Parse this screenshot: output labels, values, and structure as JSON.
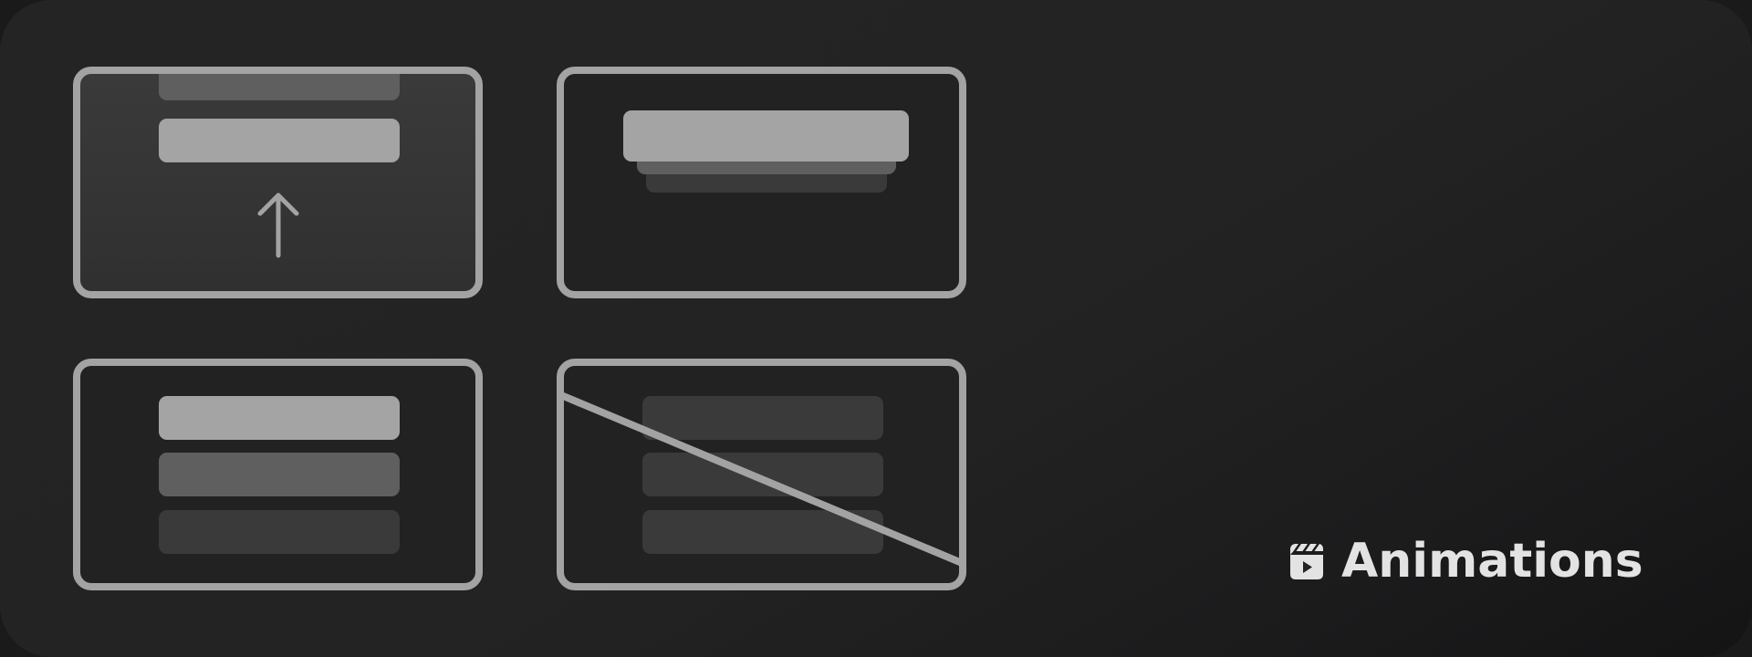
{
  "brand": {
    "name": "Animations",
    "icon": "clapperboard-play-icon"
  },
  "colors": {
    "background": "#232323",
    "tile_border": "#a3a3a3",
    "bar_light": "#a4a4a4",
    "bar_mid": "#5f5f5f",
    "bar_dark": "#3a3a3a",
    "text": "#e3e3e3"
  },
  "illustrations": [
    {
      "name": "slide-up",
      "icon": "arrow-up-icon"
    },
    {
      "name": "stack",
      "icon": "stacked-cards-icon"
    },
    {
      "name": "fade",
      "icon": "fading-list-icon"
    },
    {
      "name": "none",
      "icon": "disabled-strikethrough-icon"
    }
  ]
}
